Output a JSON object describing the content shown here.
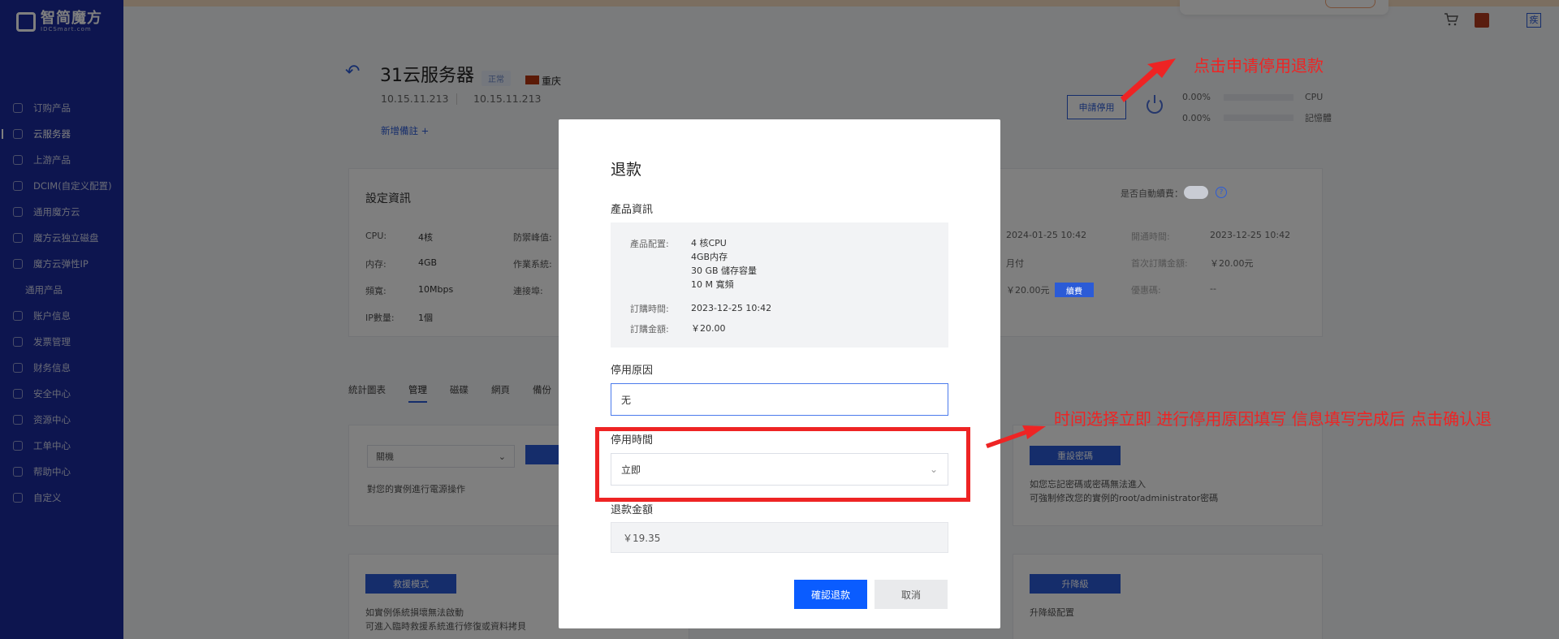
{
  "brand": {
    "logo_text": "智简魔方",
    "logo_sub": "IDCSmart.com"
  },
  "sidebar": {
    "items": [
      {
        "label": "订购产品",
        "icon": "order-icon"
      },
      {
        "label": "云服务器",
        "icon": "server-icon",
        "active": true
      },
      {
        "label": "上游产品",
        "icon": "upstream-icon"
      },
      {
        "label": "DCIM(自定义配置)",
        "icon": "dcim-icon"
      },
      {
        "label": "通用魔方云",
        "icon": "cloud-icon"
      },
      {
        "label": "魔方云独立磁盘",
        "icon": "disk-icon"
      },
      {
        "label": "魔方云弹性IP",
        "icon": "ip-icon"
      },
      {
        "label": "通用产品",
        "icon": "",
        "sub": true
      },
      {
        "label": "账户信息",
        "icon": "account-icon"
      },
      {
        "label": "发票管理",
        "icon": "invoice-icon"
      },
      {
        "label": "财务信息",
        "icon": "finance-icon"
      },
      {
        "label": "安全中心",
        "icon": "security-icon"
      },
      {
        "label": "资源中心",
        "icon": "resource-icon"
      },
      {
        "label": "工单中心",
        "icon": "ticket-icon"
      },
      {
        "label": "帮助中心",
        "icon": "help-icon"
      },
      {
        "label": "自定义",
        "icon": "custom-icon"
      }
    ]
  },
  "topbar": {
    "user_initial": "疾"
  },
  "product": {
    "title": "31云服务器",
    "status": "正常",
    "region": "重庆",
    "ip_primary": "10.15.11.213",
    "ip_secondary": "10.15.11.213",
    "add_note": "新增備註 +",
    "apply_button": "申請停用",
    "usage": [
      {
        "percent": "0.00%",
        "label": "CPU"
      },
      {
        "percent": "0.00%",
        "label": "記憶體"
      }
    ]
  },
  "config_card": {
    "title": "設定資訊",
    "auto_renew_label": "是否自動續費：",
    "left": [
      {
        "k": "CPU:",
        "v": "4核"
      },
      {
        "k": "内存:",
        "v": "4GB"
      },
      {
        "k": "頻寬:",
        "v": "10Mbps"
      },
      {
        "k": "IP數量:",
        "v": "1個"
      }
    ],
    "mid": [
      {
        "k": "防禦峰值:"
      },
      {
        "k": "作業系統:"
      },
      {
        "k": "連接埠:"
      }
    ],
    "right_values": [
      {
        "v": "2024-01-25 10:42"
      },
      {
        "v": "月付"
      },
      {
        "v": "￥20.00元",
        "badge": "續費"
      }
    ],
    "far": [
      {
        "k": "開通時間:",
        "v": "2023-12-25 10:42"
      },
      {
        "k": "首次訂購金額:",
        "v": "￥20.00元"
      },
      {
        "k": "優惠碼:",
        "v": "--"
      }
    ]
  },
  "tabs": [
    "統計圖表",
    "管理",
    "磁碟",
    "網頁",
    "備份"
  ],
  "manage": {
    "power_select": "關機",
    "power_note": "對您的實例進行電源操作",
    "reset_pwd_button": "重設密碼",
    "reset_pwd_note_1": "如您忘記密碼或密碼無法進入",
    "reset_pwd_note_2": "可強制修改您的實例的root/administrator密碼",
    "rescue_button": "救援模式",
    "rescue_note_1": "如實例係統損壞無法啟動",
    "rescue_note_2": "可進入臨時救援系統進行修復或資料拷貝",
    "upgrade_button": "升降級",
    "upgrade_note": "升降級配置"
  },
  "modal": {
    "title": "退款",
    "product_info_label": "產品資訊",
    "config_label": "產品配置:",
    "config_lines": [
      "4 核CPU",
      "4GB内存",
      "30 GB 儲存容量",
      "10 M 寬頻"
    ],
    "order_time_label": "訂購時間:",
    "order_time": "2023-12-25 10:42",
    "order_amount_label": "訂購金額:",
    "order_amount": "￥20.00",
    "reason_label": "停用原因",
    "reason_value": "无",
    "time_label": "停用時間",
    "time_value": "立即",
    "refund_label": "退款金額",
    "refund_value": "￥19.35",
    "confirm": "確認退款",
    "cancel": "取消"
  },
  "annotations": {
    "top": "点击申请停用退款",
    "middle": "时间选择立即 进行停用原因填写  信息填写完成后 点击确认退"
  }
}
